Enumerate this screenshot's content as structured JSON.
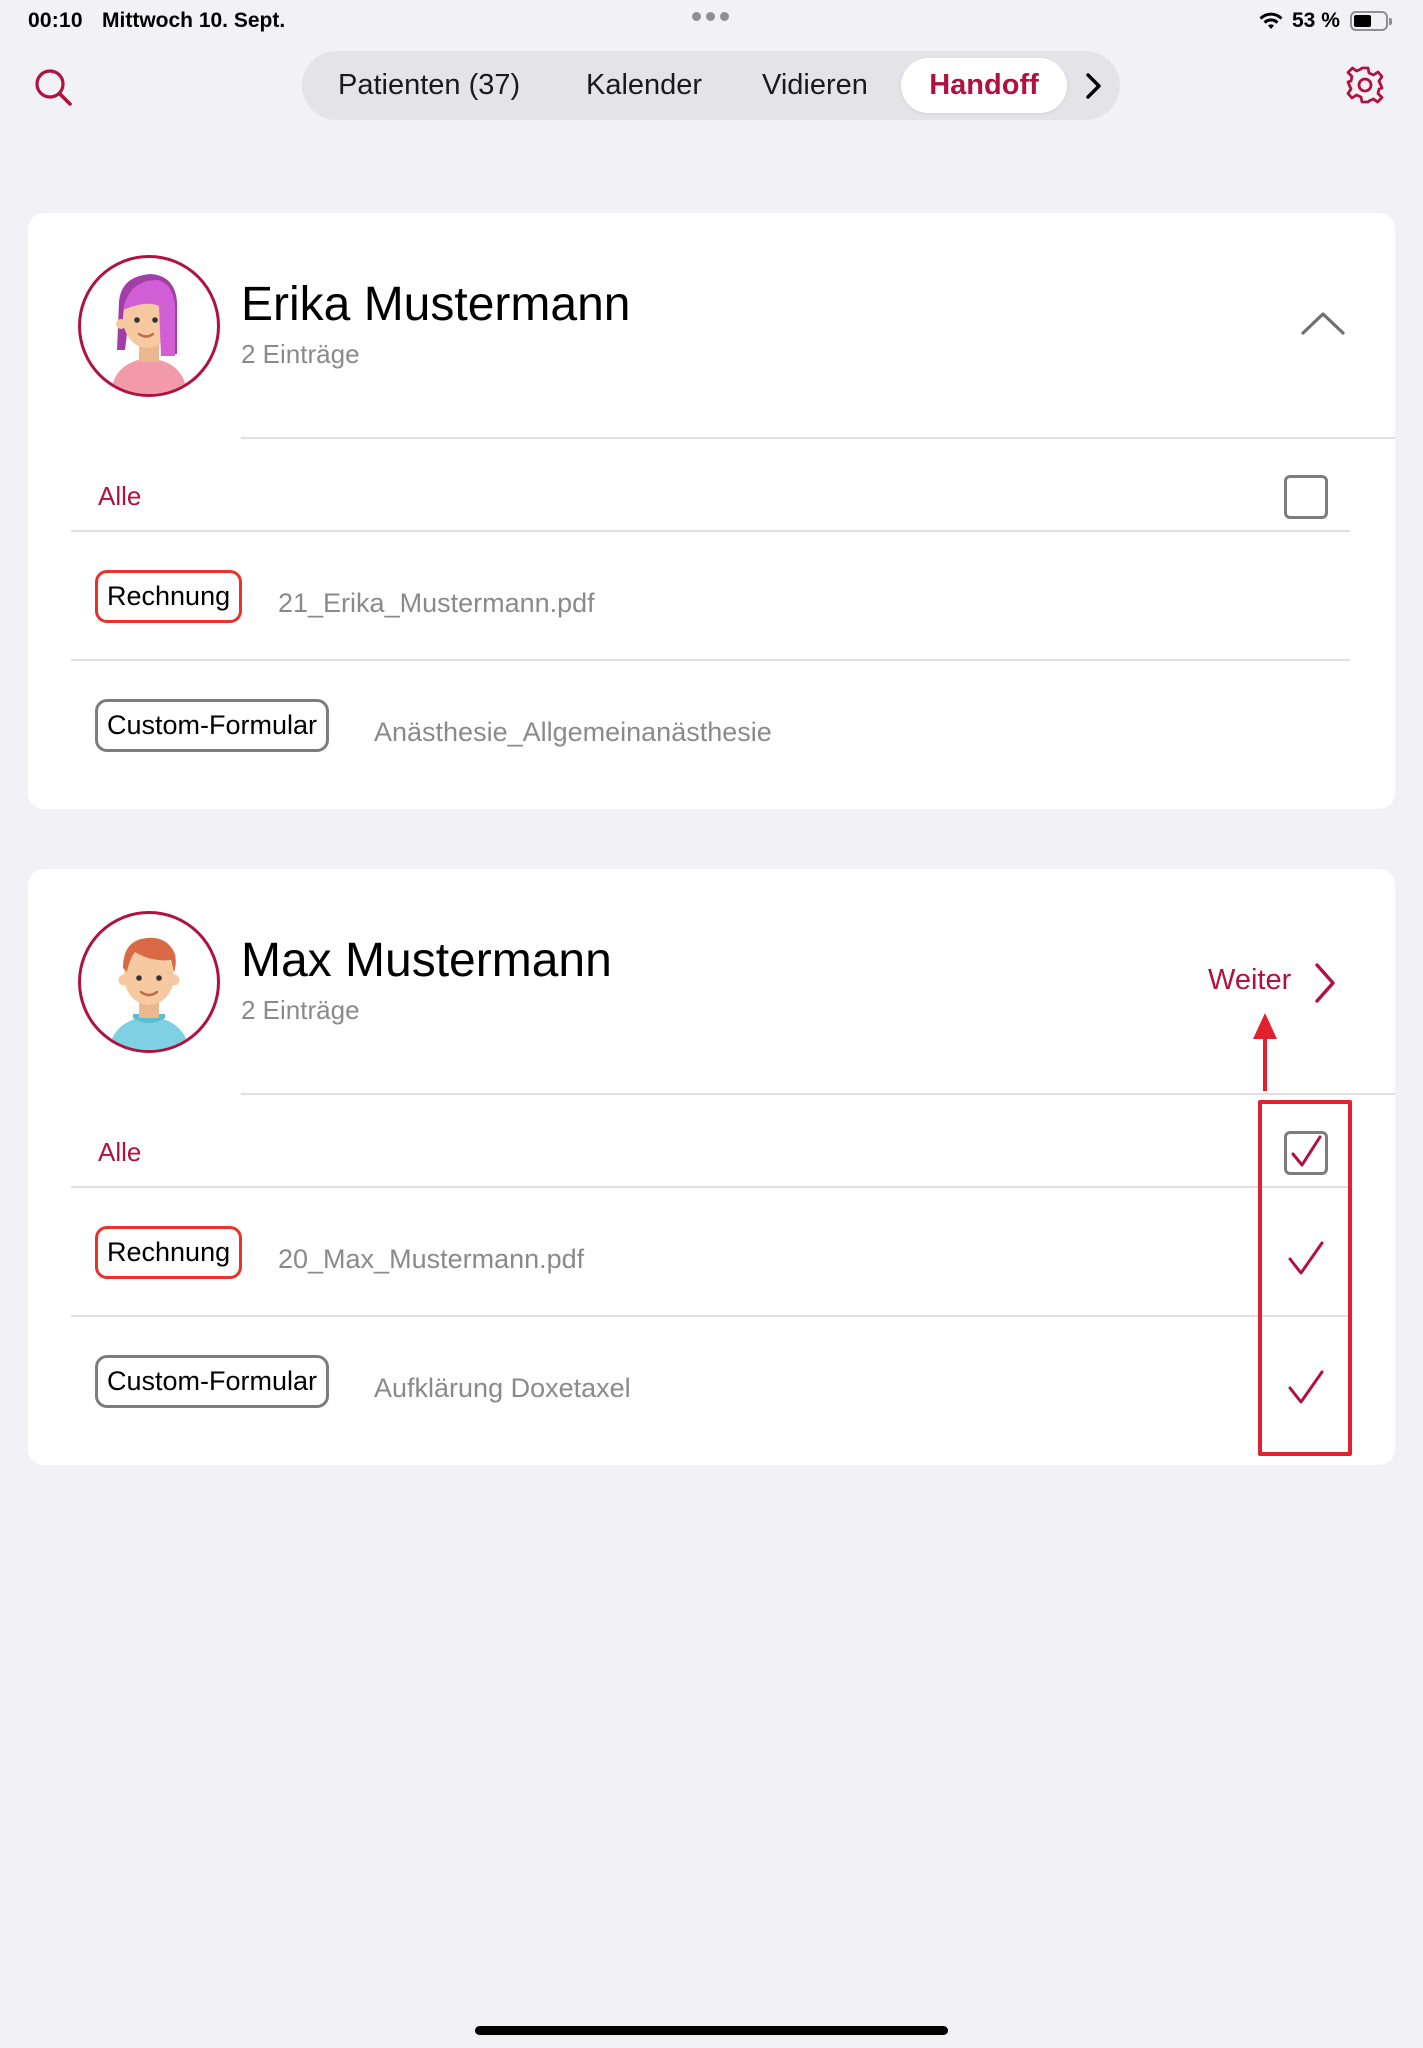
{
  "status_bar": {
    "time": "00:10",
    "date": "Mittwoch 10. Sept.",
    "battery": "53 %",
    "battery_level": 0.53
  },
  "nav": {
    "tabs": [
      {
        "label": "Patienten (37)"
      },
      {
        "label": "Kalender"
      },
      {
        "label": "Vidieren"
      },
      {
        "label": "Handoff",
        "selected": true
      }
    ],
    "icons": {
      "search": "search-icon",
      "settings": "gear-icon",
      "more": "chevron-right-icon"
    }
  },
  "colors": {
    "accent": "#b0123f",
    "tag_red": "#e8332b",
    "annotation": "#e12130",
    "background": "#f1f1f6"
  },
  "patients": [
    {
      "name": "Erika Mustermann",
      "count": "2 Einträge",
      "expanded": true,
      "select_all_label": "Alle",
      "select_all_checked": false,
      "entries": [
        {
          "tag": "Rechnung",
          "file": "21_Erika_Mustermann.pdf",
          "checked": false
        },
        {
          "tag": "Custom-Formular",
          "file": "Anästhesie_Allgemeinanästhesie",
          "checked": false
        }
      ]
    },
    {
      "name": "Max Mustermann",
      "count": "2 Einträge",
      "action_label": "Weiter",
      "select_all_label": "Alle",
      "select_all_checked": true,
      "entries": [
        {
          "tag": "Rechnung",
          "file": "20_Max_Mustermann.pdf",
          "checked": true
        },
        {
          "tag": "Custom-Formular",
          "file": "Aufklärung Doxetaxel",
          "checked": true
        }
      ]
    }
  ]
}
